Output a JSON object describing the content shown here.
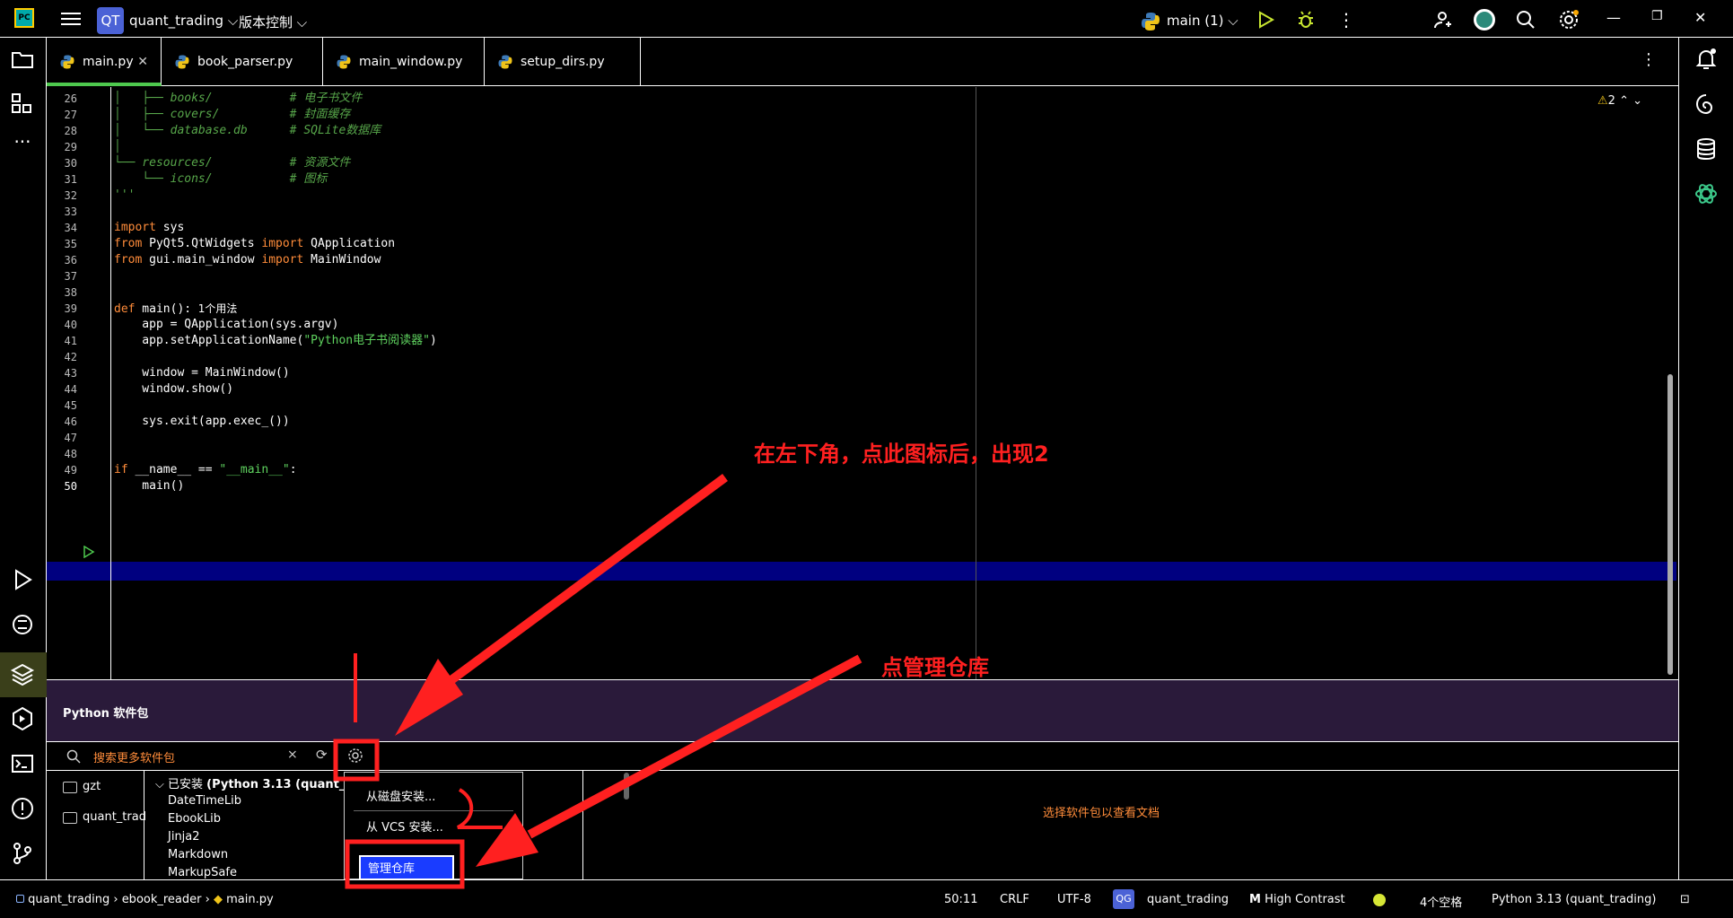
{
  "topbar": {
    "project_badge": "QT",
    "project_name": "quant_trading",
    "vcs_label": "版本控制",
    "branch_label": "main (1)"
  },
  "tabs": [
    {
      "label": "main.py",
      "active": true
    },
    {
      "label": "book_parser.py"
    },
    {
      "label": "main_window.py"
    },
    {
      "label": "setup_dirs.py"
    }
  ],
  "editor": {
    "warning_count": "2",
    "usage_hint": "1个用法",
    "lines": [
      {
        "n": "26",
        "text": "│   ├── books/           # 电子书文件"
      },
      {
        "n": "27",
        "text": "│   ├── covers/          # 封面缓存"
      },
      {
        "n": "28",
        "text": "│   └── database.db      # SQLite数据库"
      },
      {
        "n": "29",
        "text": "│"
      },
      {
        "n": "30",
        "text": "└── resources/           # 资源文件"
      },
      {
        "n": "31",
        "text": "    └── icons/           # 图标"
      },
      {
        "n": "32",
        "text": "'''"
      },
      {
        "n": "33",
        "text": ""
      },
      {
        "n": "34",
        "text": "import sys"
      },
      {
        "n": "35",
        "text": "from PyQt5.QtWidgets import QApplication"
      },
      {
        "n": "36",
        "text": "from gui.main_window import MainWindow"
      },
      {
        "n": "37",
        "text": ""
      },
      {
        "n": "38",
        "text": ""
      },
      {
        "n": "39",
        "text": "def main():"
      },
      {
        "n": "40",
        "text": "    app = QApplication(sys.argv)"
      },
      {
        "n": "41",
        "text": "    app.setApplicationName(\"Python电子书阅读器\")"
      },
      {
        "n": "42",
        "text": ""
      },
      {
        "n": "43",
        "text": "    window = MainWindow()"
      },
      {
        "n": "44",
        "text": "    window.show()"
      },
      {
        "n": "45",
        "text": ""
      },
      {
        "n": "46",
        "text": "    sys.exit(app.exec_())"
      },
      {
        "n": "47",
        "text": ""
      },
      {
        "n": "48",
        "text": ""
      },
      {
        "n": "49",
        "text": "if __name__ == \"__main__\":"
      },
      {
        "n": "50",
        "text": "    main()"
      }
    ]
  },
  "packages": {
    "title": "Python 软件包",
    "search_placeholder": "搜索更多软件包",
    "repos": [
      "gzt",
      "quant_trad"
    ],
    "installed_group_prefix": "已安装",
    "installed_group_env": "(Python 3.13 (quant_",
    "items": [
      "DateTimeLib",
      "EbookLib",
      "Jinja2",
      "Markdown",
      "MarkupSafe"
    ],
    "doc_placeholder": "选择软件包以查看文档"
  },
  "menu": {
    "items": [
      "从磁盘安装...",
      "从 VCS 安装...",
      "管理仓库"
    ]
  },
  "status": {
    "crumbs": [
      "quant_trading",
      "ebook_reader",
      "main.py"
    ],
    "position": "50:11",
    "line_sep": "CRLF",
    "encoding": "UTF-8",
    "proj_badge": "QG",
    "proj": "quant_trading",
    "theme": "High Contrast",
    "indent": "4个空格",
    "interpreter": "Python 3.13 (quant_trading)"
  },
  "annotations": {
    "note1": "在左下角，点此图标后，出现2",
    "note2": "点管理仓库",
    "mark1": "1",
    "mark2": "2",
    "color": "#ff2020"
  }
}
